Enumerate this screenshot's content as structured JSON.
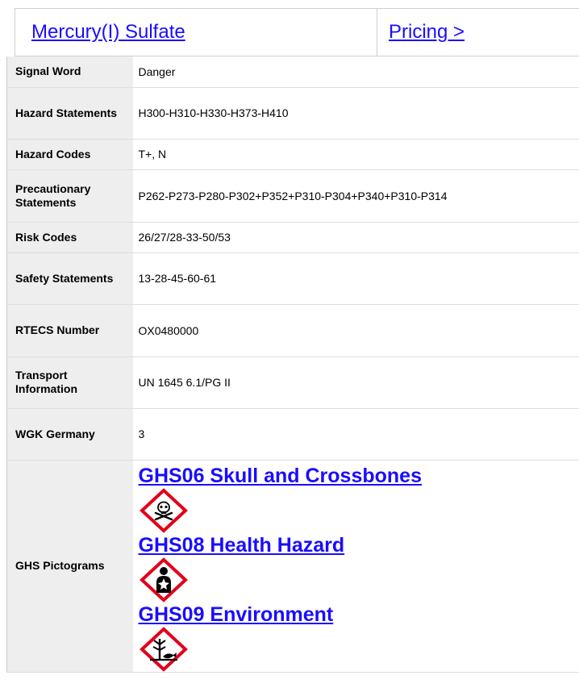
{
  "header": {
    "compound_link": "Mercury(I) Sulfate",
    "pricing_link": "Pricing >"
  },
  "rows": [
    {
      "label": "Signal Word",
      "value": "Danger"
    },
    {
      "label": "Hazard Statements",
      "value": "H300-H310-H330-H373-H410"
    },
    {
      "label": "Hazard Codes",
      "value": "T+, N"
    },
    {
      "label": "Precautionary Statements",
      "value": "P262-P273-P280-P302+P352+P310-P304+P340+P310-P314"
    },
    {
      "label": "Risk Codes",
      "value": "26/27/28-33-50/53"
    },
    {
      "label": "Safety Statements",
      "value": "13-28-45-60-61"
    },
    {
      "label": "RTECS Number",
      "value": "OX0480000"
    },
    {
      "label": "Transport Information",
      "value": "UN 1645 6.1/PG II"
    },
    {
      "label": "WGK Germany",
      "value": "3"
    }
  ],
  "pictograms": {
    "label": "GHS Pictograms",
    "items": [
      {
        "title": "GHS06 Skull and Crossbones",
        "icon": "skull-crossbones-icon"
      },
      {
        "title": "GHS08 Health Hazard",
        "icon": "health-hazard-icon"
      },
      {
        "title": "GHS09 Environment",
        "icon": "environment-icon"
      }
    ]
  },
  "colors": {
    "link": "#1a0dff",
    "label_bg": "#eeeeee",
    "ghs_red": "#e2001a"
  }
}
